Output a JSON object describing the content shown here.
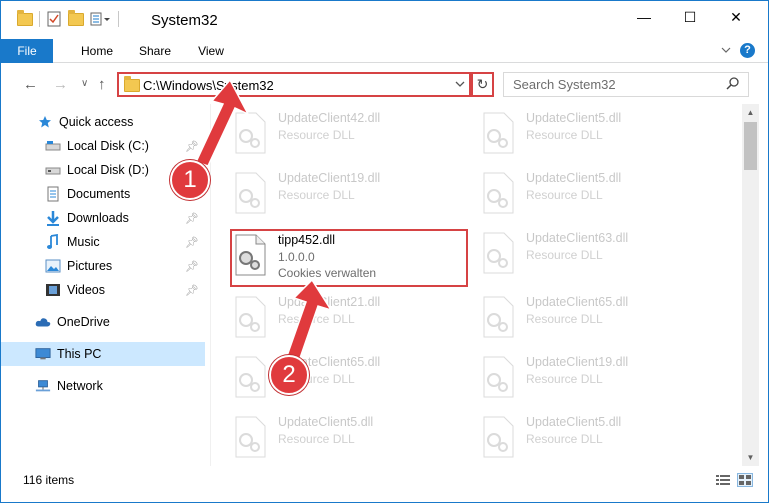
{
  "window": {
    "title": "System32",
    "controls": {
      "minimize": "—",
      "maximize": "☐",
      "close": "✕"
    }
  },
  "ribbon": {
    "tabs": [
      "File",
      "Home",
      "Share",
      "View"
    ],
    "expand_icon": "chevron-down-icon",
    "help_icon": "help-icon",
    "help_glyph": "?"
  },
  "navigation": {
    "back": "←",
    "forward": "→",
    "recent": "∨",
    "up": "↑",
    "address": "C:\\Windows\\System32",
    "refresh": "↻",
    "search_placeholder": "Search System32"
  },
  "sidebar": {
    "items": [
      {
        "label": "Quick access",
        "icon": "star-icon",
        "pinned": false
      },
      {
        "label": "Local Disk (C:)",
        "icon": "drive-icon",
        "pinned": true
      },
      {
        "label": "Local Disk (D:)",
        "icon": "drive-icon",
        "pinned": true
      },
      {
        "label": "Documents",
        "icon": "documents-icon",
        "pinned": true
      },
      {
        "label": "Downloads",
        "icon": "downloads-icon",
        "pinned": true
      },
      {
        "label": "Music",
        "icon": "music-icon",
        "pinned": true
      },
      {
        "label": "Pictures",
        "icon": "pictures-icon",
        "pinned": true
      },
      {
        "label": "Videos",
        "icon": "videos-icon",
        "pinned": true
      },
      {
        "label": "OneDrive",
        "icon": "cloud-icon",
        "pinned": false
      },
      {
        "label": "This PC",
        "icon": "computer-icon",
        "pinned": false,
        "selected": true
      },
      {
        "label": "Network",
        "icon": "network-icon",
        "pinned": false
      }
    ]
  },
  "files": {
    "left_column": [
      {
        "name": "UpdateClient42.dll",
        "type": "Resource DLL"
      },
      {
        "name": "UpdateClient19.dll",
        "type": "Resource DLL"
      },
      {
        "name": "tipp452.dll",
        "version": "1.0.0.0",
        "description": "Cookies verwalten"
      },
      {
        "name": "UpdateClient21.dll",
        "type": "Resource DLL"
      },
      {
        "name": "UpdateClient65.dll",
        "type": "Resource DLL"
      },
      {
        "name": "UpdateClient5.dll",
        "type": "Resource DLL"
      }
    ],
    "right_column": [
      {
        "name": "UpdateClient5.dll",
        "type": "Resource DLL"
      },
      {
        "name": "UpdateClient5.dll",
        "type": "Resource DLL"
      },
      {
        "name": "UpdateClient63.dll",
        "type": "Resource DLL"
      },
      {
        "name": "UpdateClient65.dll",
        "type": "Resource DLL"
      },
      {
        "name": "UpdateClient19.dll",
        "type": "Resource DLL"
      },
      {
        "name": "UpdateClient5.dll",
        "type": "Resource DLL"
      }
    ]
  },
  "annotations": {
    "step1": "1",
    "step2": "2",
    "highlight_color": "#d64344"
  },
  "status": {
    "item_count": "116 items"
  },
  "colors": {
    "accent": "#1979ca",
    "selection": "#cce8ff",
    "callout": "#e03a3d"
  }
}
